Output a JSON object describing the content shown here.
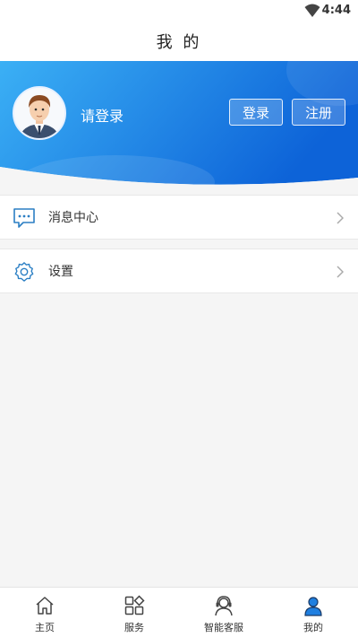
{
  "status_bar": {
    "time": "4:44"
  },
  "header": {
    "title": "我 的"
  },
  "profile": {
    "login_prompt": "请登录",
    "login_button": "登录",
    "register_button": "注册"
  },
  "menu": [
    {
      "label": "消息中心",
      "icon": "message-icon"
    },
    {
      "label": "设置",
      "icon": "gear-icon"
    }
  ],
  "tabs": [
    {
      "label": "主页",
      "icon": "home-icon",
      "active": false
    },
    {
      "label": "服务",
      "icon": "grid-icon",
      "active": false
    },
    {
      "label": "智能客服",
      "icon": "headset-icon",
      "active": false
    },
    {
      "label": "我的",
      "icon": "user-icon",
      "active": true
    }
  ],
  "colors": {
    "accent": "#1f7fe0",
    "banner_start": "#3bb0f5",
    "banner_end": "#0d63d8"
  }
}
